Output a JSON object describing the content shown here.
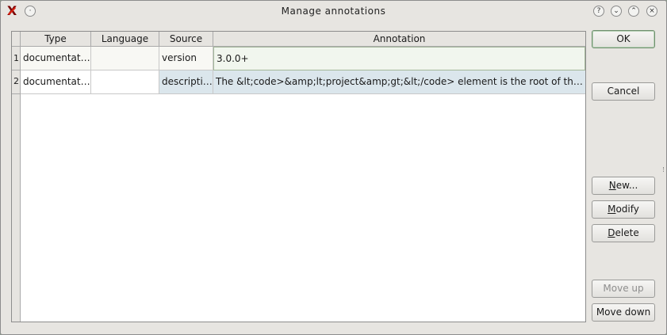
{
  "window": {
    "title": "Manage annotations"
  },
  "titlebar_buttons": [
    "?",
    "⌄",
    "⌃",
    "×"
  ],
  "table": {
    "columns": [
      "Type",
      "Language",
      "Source",
      "Annotation"
    ],
    "rows": [
      {
        "num": "1",
        "type": "documentation",
        "language": "",
        "source": "version",
        "annotation": "3.0.0+"
      },
      {
        "num": "2",
        "type": "documentation",
        "language": "",
        "source": "description",
        "annotation": "The &lt;code>&amp;lt;project&amp;gt;&lt;/code> element is the root of the descripto..."
      }
    ]
  },
  "buttons": {
    "ok": "OK",
    "cancel": "Cancel",
    "new_first": "N",
    "new_rest": "ew...",
    "modify_first": "M",
    "modify_rest": "odify",
    "delete_first": "D",
    "delete_rest": "elete",
    "move_up": "Move up",
    "move_down": "Move down"
  }
}
